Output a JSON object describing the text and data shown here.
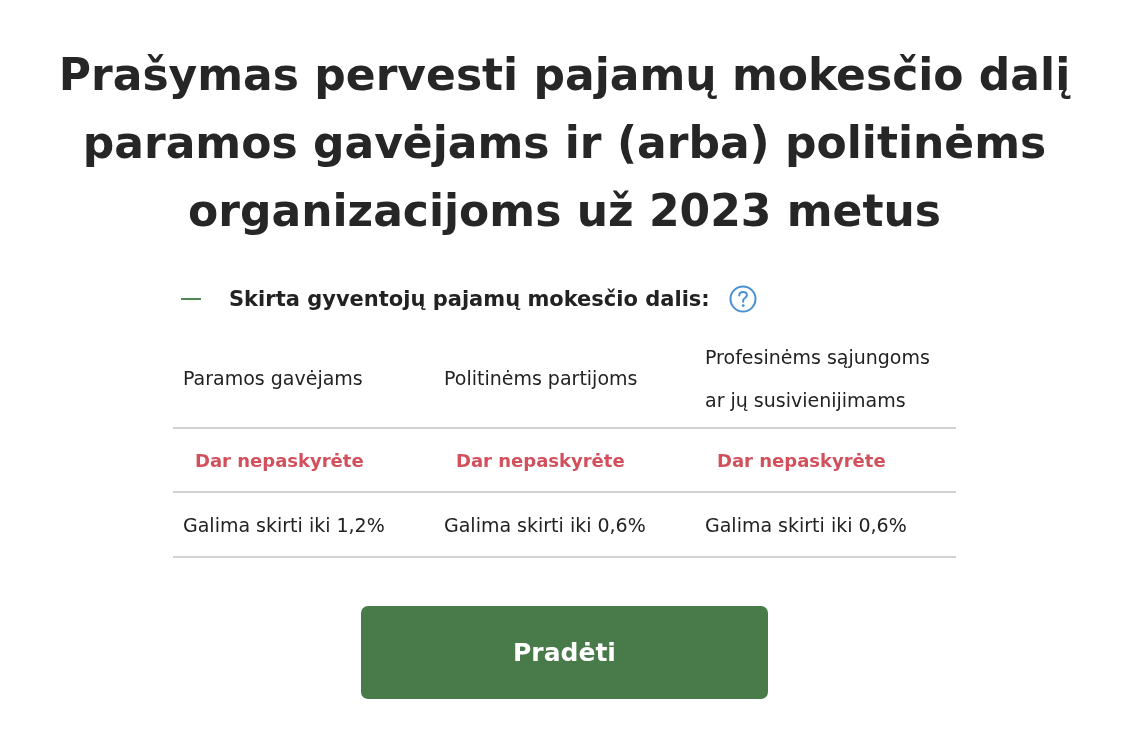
{
  "title": "Prašymas pervesti pajamų mokesčio dalį paramos gavėjams ir (arba) politinėms organizacijoms už 2023 metus",
  "allocation": {
    "expanded": true,
    "heading": "Skirta gyventojų pajamų mokesčio dalis:",
    "table": {
      "columns": [
        "Paramos gavėjams",
        "Politinėms partijoms",
        "Profesinėms sąjungoms ar jų susivienijimams"
      ],
      "rows": [
        {
          "kind": "status",
          "cells": [
            "Dar nepaskyrėte",
            "Dar nepaskyrėte",
            "Dar nepaskyrėte"
          ]
        },
        {
          "kind": "limit",
          "cells": [
            "Galima skirti iki 1,2%",
            "Galima skirti iki 0,6%",
            "Galima skirti iki 0,6%"
          ]
        }
      ]
    }
  },
  "start_button": {
    "label": "Pradėti"
  }
}
